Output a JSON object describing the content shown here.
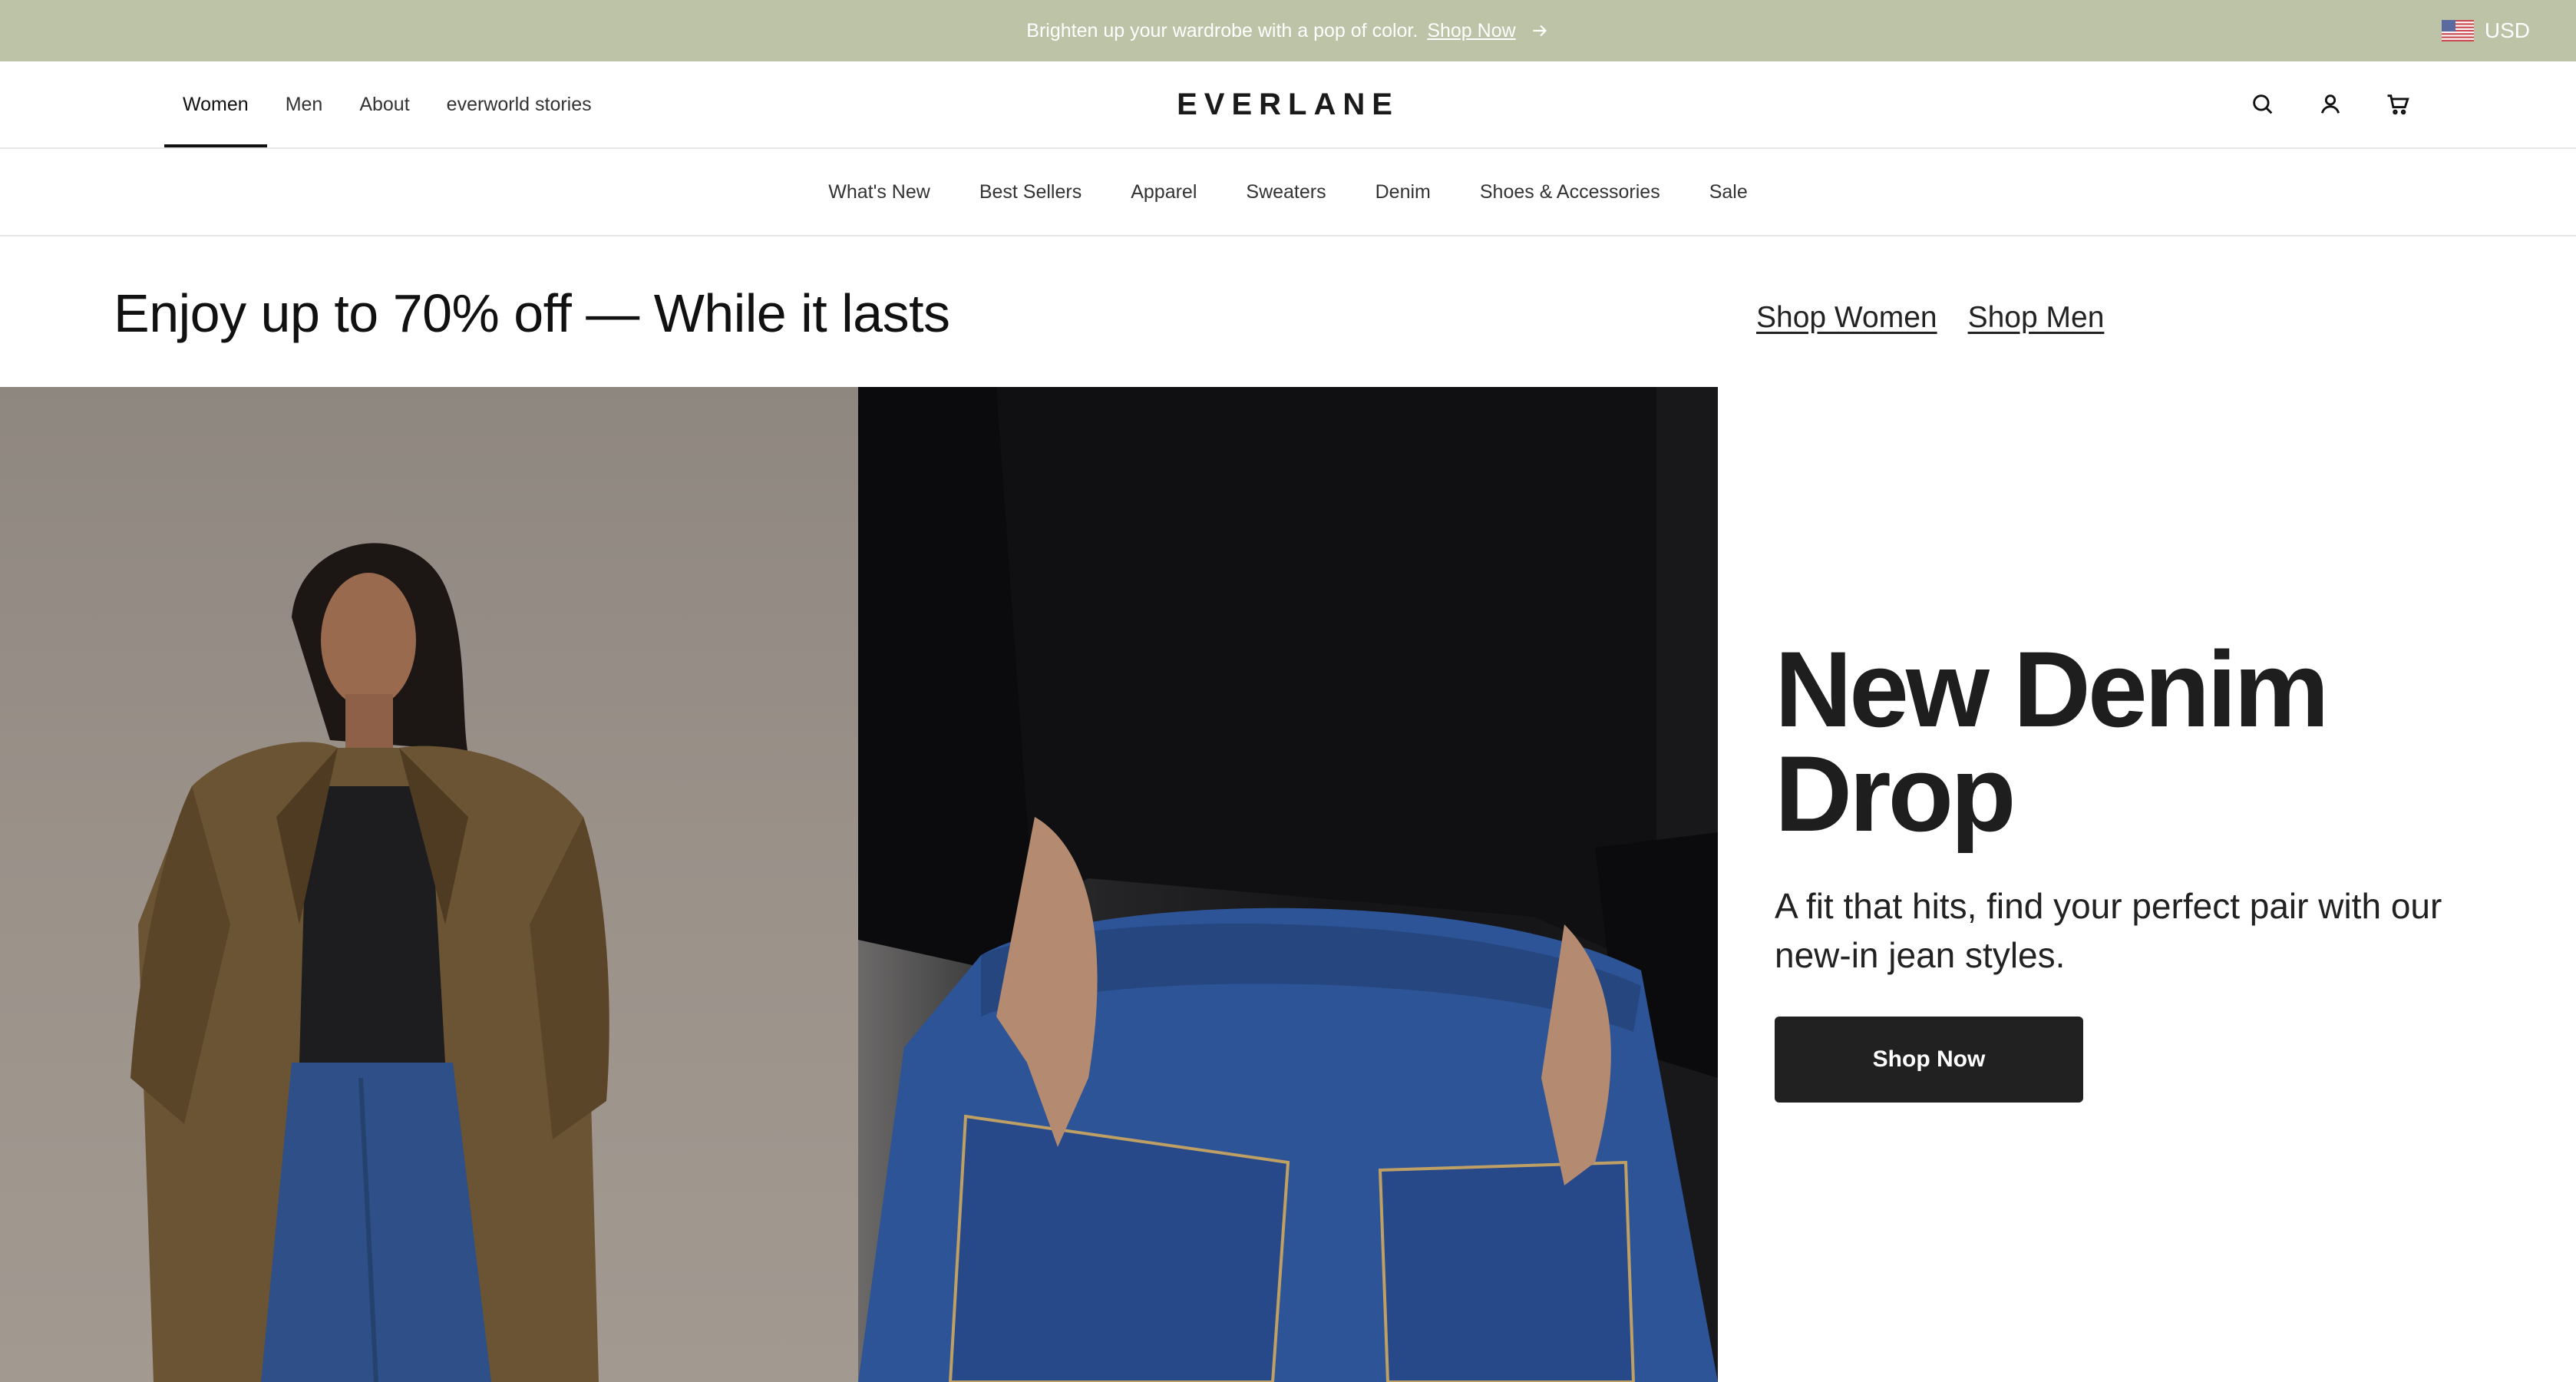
{
  "announcement": {
    "text": "Brighten up your wardrobe with a pop of color.",
    "link_label": "Shop Now",
    "icons": {
      "arrow": "arrow-right-icon"
    },
    "background_color": "#bcc3a6"
  },
  "currency": {
    "label": "USD",
    "flag_icon": "us-flag-icon"
  },
  "header": {
    "logo": "EVERLANE",
    "primary_nav": [
      "Women",
      "Men",
      "About",
      "everworld stories"
    ],
    "active_item": "Women",
    "utility_icons": [
      "search-icon",
      "account-icon",
      "cart-icon"
    ]
  },
  "category_nav": [
    "What's New",
    "Best Sellers",
    "Apparel",
    "Sweaters",
    "Denim",
    "Shoes & Accessories",
    "Sale"
  ],
  "promo": {
    "title": "Enjoy up to 70% off — While it lasts",
    "links": [
      "Shop Women",
      "Shop Men"
    ]
  },
  "hero": {
    "title_line1": "New Denim",
    "title_line2": "Drop",
    "subtitle": "A fit that hits, find your perfect pair with our new-in jean styles.",
    "button": "Shop Now",
    "button_color": "#212121"
  }
}
